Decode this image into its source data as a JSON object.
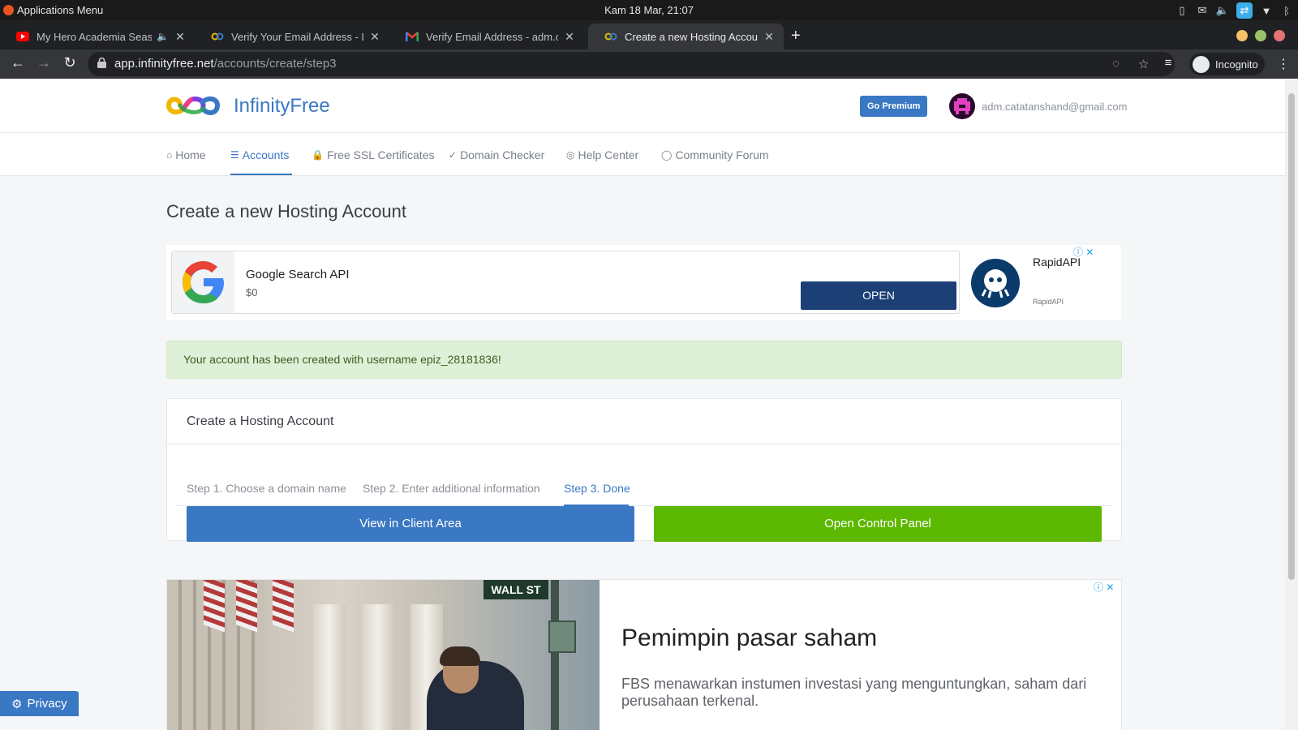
{
  "os": {
    "apps_menu": "Applications Menu",
    "clock": "Kam 18 Mar, 21:07",
    "tray_icons": [
      "phone-icon",
      "mail-icon",
      "volume-icon",
      "teamviewer-icon",
      "wifi-icon",
      "bluetooth-icon"
    ]
  },
  "tabs": [
    {
      "title": "My Hero Academia Season",
      "favicon": "youtube-icon",
      "audio": "🔈"
    },
    {
      "title": "Verify Your Email Address - Infin",
      "favicon": "infinityfree-icon"
    },
    {
      "title": "Verify Email Address - adm.cata",
      "favicon": "gmail-icon"
    },
    {
      "title": "Create a new Hosting Account -",
      "favicon": "infinityfree-icon",
      "active": true
    }
  ],
  "browser": {
    "url_host": "app.infinityfree.net",
    "url_path": "/accounts/create/step3",
    "profile_label": "Incognito",
    "close_symbol": "✕",
    "newtab_symbol": "+"
  },
  "header": {
    "brand": "InfinityFree",
    "premium_button": "Go Premium",
    "user_email": "adm.catatanshand@gmail.com"
  },
  "nav": [
    {
      "label": "Home",
      "icon": "home-icon",
      "glyph": "⌂"
    },
    {
      "label": "Accounts",
      "icon": "server-icon",
      "glyph": "☰",
      "active": true
    },
    {
      "label": "Free SSL Certificates",
      "icon": "lock-icon",
      "glyph": "🔒"
    },
    {
      "label": "Domain Checker",
      "icon": "check-circle-icon",
      "glyph": "✓"
    },
    {
      "label": "Help Center",
      "icon": "lifebuoy-icon",
      "glyph": "◎"
    },
    {
      "label": "Community Forum",
      "icon": "chat-icon",
      "glyph": "◯"
    }
  ],
  "page_title": "Create a new Hosting Account",
  "ad_top": {
    "title": "Google Search API",
    "price": "$0",
    "button": "OPEN",
    "advertiser": "RapidAPI",
    "advertiser_sub": "RapidAPI",
    "adchoices": "ⓘ ✕"
  },
  "alert": {
    "message": "Your account has been created with username epiz_28181836!"
  },
  "card": {
    "title": "Create a Hosting Account",
    "steps": [
      {
        "label": "Step 1. Choose a domain name"
      },
      {
        "label": "Step 2. Enter additional information"
      },
      {
        "label": "Step 3. Done",
        "active": true
      }
    ],
    "client_area_button": "View in Client Area",
    "control_panel_button": "Open Control Panel"
  },
  "ad_bottom": {
    "sign": "WALL ST",
    "headline": "Pemimpin pasar saham",
    "description": "FBS menawarkan instumen investasi yang menguntungkan, saham dari perusahaan terkenal.",
    "adchoices": "ⓘ ✕"
  },
  "privacy_label": "Privacy",
  "colors": {
    "brand_blue": "#3a78c3",
    "success_green": "#5cb800",
    "alert_bg": "#dff0d8",
    "ad_button": "#1c3f75"
  }
}
